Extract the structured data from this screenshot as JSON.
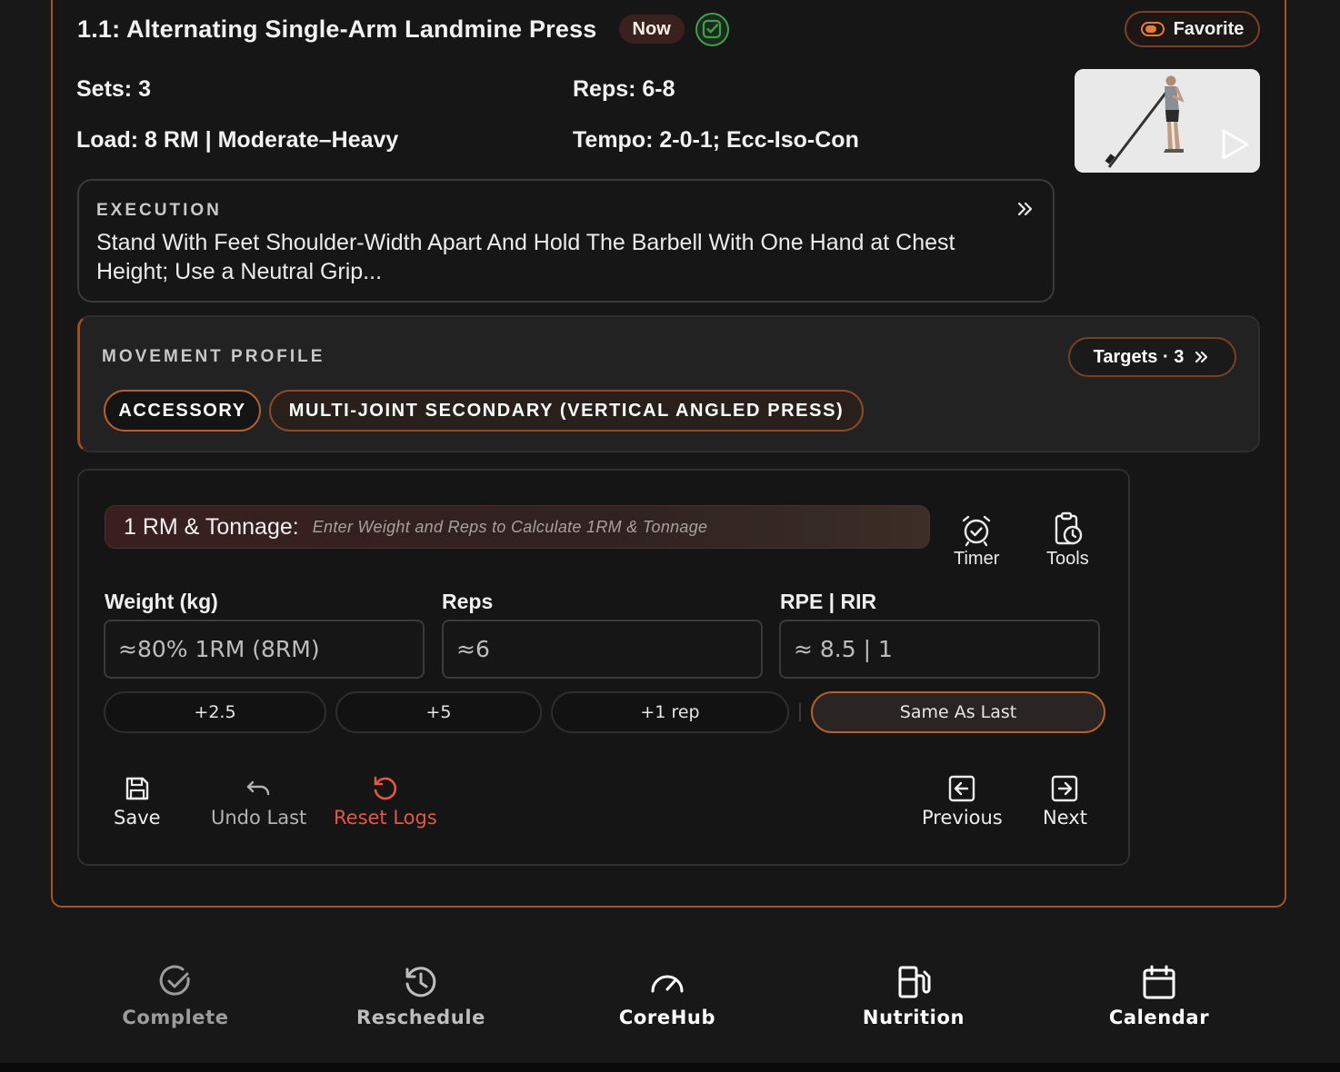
{
  "exercise": {
    "title": "1.1: Alternating Single-Arm Landmine Press",
    "now_badge": "Now",
    "favorite_label": "Favorite",
    "sets": "Sets: 3",
    "reps": "Reps: 6-8",
    "load": "Load: 8 RM | Moderate–Heavy",
    "tempo": "Tempo: 2-0-1; Ecc-Iso-Con"
  },
  "execution": {
    "eyebrow": "EXECUTION",
    "text": "Stand With Feet Shoulder-Width Apart And Hold The Barbell With One Hand at Chest Height; Use a Neutral Grip..."
  },
  "movement_profile": {
    "eyebrow": "MOVEMENT PROFILE",
    "targets_label": "Targets · 3",
    "chips": [
      "ACCESSORY",
      "MULTI-JOINT SECONDARY (VERTICAL ANGLED PRESS)"
    ]
  },
  "logger": {
    "rm_label": "1 RM & Tonnage:",
    "rm_hint": "Enter Weight and Reps to Calculate 1RM & Tonnage",
    "timer_label": "Timer",
    "tools_label": "Tools",
    "fields": [
      {
        "label": "Weight (kg)",
        "placeholder": "≈80% 1RM (8RM)"
      },
      {
        "label": "Reps",
        "placeholder": "≈6"
      },
      {
        "label": "RPE | RIR",
        "placeholder": "≈ 8.5 | 1"
      }
    ],
    "quick_buttons": [
      "+2.5",
      "+5",
      "+1 rep",
      "Same As Last"
    ],
    "actions": {
      "save": "Save",
      "undo": "Undo Last",
      "reset": "Reset Logs",
      "previous": "Previous",
      "next": "Next"
    }
  },
  "bottom_nav": [
    {
      "label": "Complete",
      "icon": "check-circle-icon"
    },
    {
      "label": "Reschedule",
      "icon": "history-icon"
    },
    {
      "label": "CoreHub",
      "icon": "gauge-icon"
    },
    {
      "label": "Nutrition",
      "icon": "fuel-icon"
    },
    {
      "label": "Calendar",
      "icon": "calendar-icon"
    }
  ],
  "colors": {
    "accent_orange": "#b2602e",
    "reset_red": "#e0584a",
    "check_green": "#3fa04c",
    "background": "#181818"
  }
}
